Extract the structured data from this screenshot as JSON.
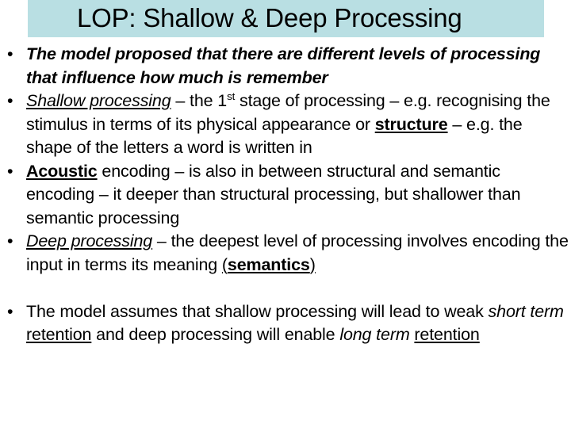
{
  "slide": {
    "title": "LOP: Shallow & Deep Processing",
    "title_band_color": "#b9dfe3",
    "background_color": "#ffffff",
    "text_color": "#000000",
    "bullet_glyph": "•",
    "bullets": [
      {
        "id": "bullet-levels-of-processing",
        "style": "bold-italic",
        "runs": [
          {
            "text": "The model proposed that there are different levels of processing that influence how much is remember",
            "format": "bold-italic"
          }
        ],
        "plain": "The model proposed that there are different levels of processing that influence how much is remember"
      },
      {
        "id": "bullet-shallow-processing",
        "style": "normal",
        "runs": [
          {
            "text": "Shallow processing",
            "format": "italic-underline"
          },
          {
            "text": " – the 1",
            "format": "normal"
          },
          {
            "text": "st",
            "format": "superscript"
          },
          {
            "text": " stage of processing – e.g. recognising the stimulus in terms of its physical appearance or ",
            "format": "normal"
          },
          {
            "text": "structure",
            "format": "bold-underline"
          },
          {
            "text": " – e.g.  the shape of the letters a word is written in",
            "format": "normal"
          }
        ],
        "plain": "Shallow processing – the 1st stage of processing – e.g. recognising the stimulus in terms of its physical appearance or structure – e.g.  the shape of the letters a word is written in"
      },
      {
        "id": "bullet-acoustic-encoding",
        "style": "normal",
        "runs": [
          {
            "text": "Acoustic",
            "format": "bold-underline"
          },
          {
            "text": " encoding – is also in between structural and semantic encoding – it deeper than structural processing, but shallower than semantic processing",
            "format": "normal"
          }
        ],
        "plain": "Acoustic encoding – is also in between structural and semantic encoding – it deeper than structural processing, but shallower than semantic processing"
      },
      {
        "id": "bullet-deep-processing",
        "style": "normal",
        "runs": [
          {
            "text": "Deep processing",
            "format": "italic-underline"
          },
          {
            "text": " – the deepest level of processing involves encoding the input in terms its meaning ",
            "format": "normal"
          },
          {
            "text": "(",
            "format": "underline"
          },
          {
            "text": "semantics",
            "format": "bold-underline"
          },
          {
            "text": ")",
            "format": "underline"
          }
        ],
        "plain": "Deep processing – the deepest level of processing involves encoding the input in terms its meaning (semantics)"
      },
      {
        "id": "bullet-model-assumes",
        "style": "normal",
        "spacer_before": true,
        "runs": [
          {
            "text": "The model assumes that shallow processing will lead to weak ",
            "format": "normal"
          },
          {
            "text": "short term",
            "format": "italic"
          },
          {
            "text": " ",
            "format": "normal"
          },
          {
            "text": "retention",
            "format": "underline"
          },
          {
            "text": " and deep processing will enable ",
            "format": "normal"
          },
          {
            "text": "long term",
            "format": "italic"
          },
          {
            "text": " ",
            "format": "normal"
          },
          {
            "text": "retention",
            "format": "underline"
          }
        ],
        "plain": "The model assumes that shallow processing will lead to weak short term retention and deep processing will enable long term retention"
      }
    ]
  }
}
